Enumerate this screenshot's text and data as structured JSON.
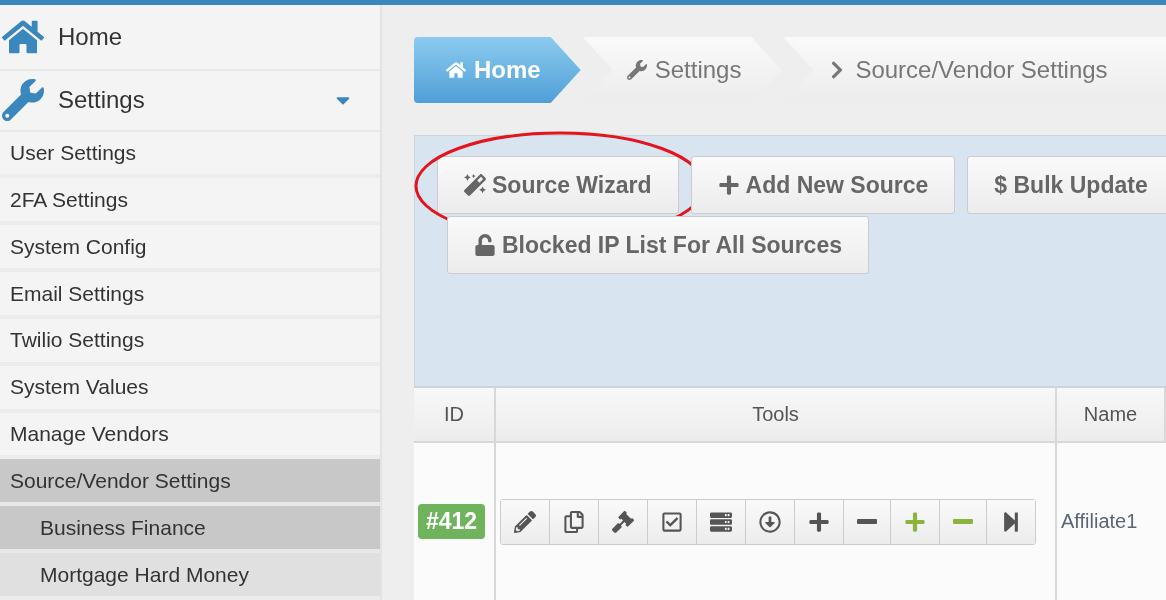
{
  "sidebar": {
    "top_items": [
      {
        "kind": "home",
        "label": "Home",
        "expanded": false
      },
      {
        "kind": "settings",
        "label": "Settings",
        "expanded": true
      }
    ],
    "items": [
      {
        "label": "User Settings",
        "selected": false
      },
      {
        "label": "2FA Settings",
        "selected": false
      },
      {
        "label": "System Config",
        "selected": false
      },
      {
        "label": "Email Settings",
        "selected": false
      },
      {
        "label": "Twilio Settings",
        "selected": false
      },
      {
        "label": "System Values",
        "selected": false
      },
      {
        "label": "Manage Vendors",
        "selected": false
      },
      {
        "label": "Source/Vendor Settings",
        "selected": true,
        "children": [
          {
            "label": "Business Finance",
            "selected": true
          },
          {
            "label": "Mortgage Hard Money",
            "selected": false
          }
        ]
      }
    ]
  },
  "breadcrumb": [
    {
      "kind": "home",
      "label": "Home",
      "selected": true
    },
    {
      "kind": "settings",
      "label": "Settings",
      "selected": false
    },
    {
      "kind": "page",
      "label": "Source/Vendor Settings",
      "selected": false
    }
  ],
  "toolbar": [
    {
      "kind": "wizard",
      "label": "Source Wizard",
      "highlighted": true
    },
    {
      "kind": "add",
      "label": "Add New Source",
      "highlighted": false
    },
    {
      "kind": "bulk",
      "label": "$ Bulk Update",
      "highlighted": false
    },
    {
      "kind": "blocked",
      "label": "Blocked IP List For All Sources",
      "highlighted": false
    }
  ],
  "table": {
    "columns": [
      "ID",
      "Tools",
      "Name"
    ],
    "rows": [
      {
        "id": "#412",
        "name": "Affiliate1",
        "tools": [
          {
            "kind": "edit",
            "color": "#555555"
          },
          {
            "kind": "copy",
            "color": "#555555"
          },
          {
            "kind": "gavel",
            "color": "#555555"
          },
          {
            "kind": "check",
            "color": "#555555"
          },
          {
            "kind": "list",
            "color": "#555555"
          },
          {
            "kind": "download",
            "color": "#555555"
          },
          {
            "kind": "plus",
            "color": "#555555"
          },
          {
            "kind": "minus",
            "color": "#555555"
          },
          {
            "kind": "plus",
            "color": "#8cb33c"
          },
          {
            "kind": "minus",
            "color": "#8cb33c"
          },
          {
            "kind": "step",
            "color": "#555555"
          }
        ]
      }
    ]
  }
}
